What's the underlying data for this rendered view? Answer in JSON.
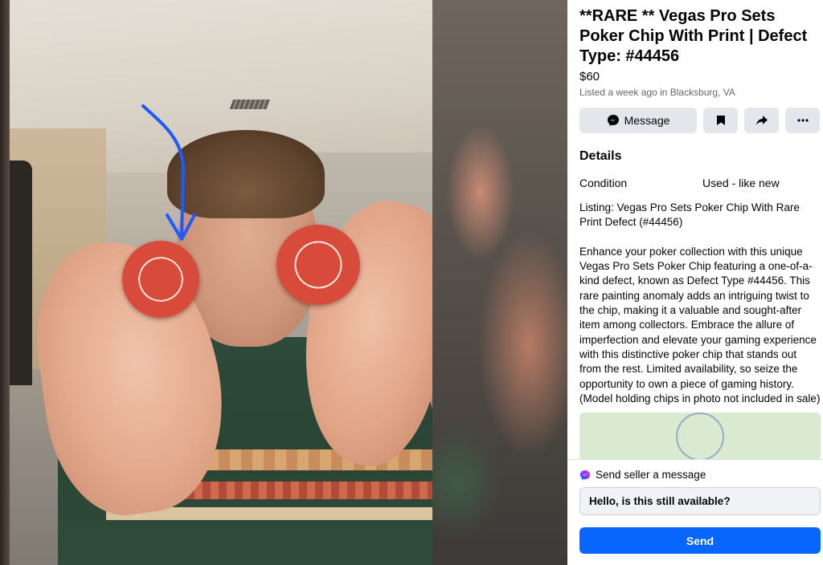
{
  "listing": {
    "title": "**RARE ** Vegas Pro Sets Poker Chip With Print | Defect Type: #44456",
    "price": "$60",
    "meta": "Listed a week ago in Blacksburg, VA"
  },
  "actions": {
    "message_label": "Message",
    "icons": [
      "messenger-icon",
      "bookmark-icon",
      "share-icon",
      "more-icon"
    ]
  },
  "details": {
    "heading": "Details",
    "condition_label": "Condition",
    "condition_value": "Used - like new",
    "description": "Listing: Vegas Pro Sets Poker Chip With Rare Print Defect (#44456)\n\nEnhance your poker collection with this unique Vegas Pro Sets Poker Chip featuring a one-of-a-kind defect, known as Defect Type #44456. This rare painting anomaly adds an intriguing twist to the chip, making it a valuable and sought-after item among collectors. Embrace the allure of imperfection and elevate your gaming experience with this distinctive poker chip that stands out from the rest. Limited availability, so seize the opportunity to own a piece of gaming history. (Model holding chips in photo not included in sale)"
  },
  "composer": {
    "label": "Send seller a message",
    "input_value": "Hello, is this still available?",
    "send_label": "Send"
  },
  "colors": {
    "accent": "#0866ff",
    "button_bg": "#e4e6eb",
    "chip_red": "#d84a3a",
    "arrow_blue": "#1e5bff"
  }
}
